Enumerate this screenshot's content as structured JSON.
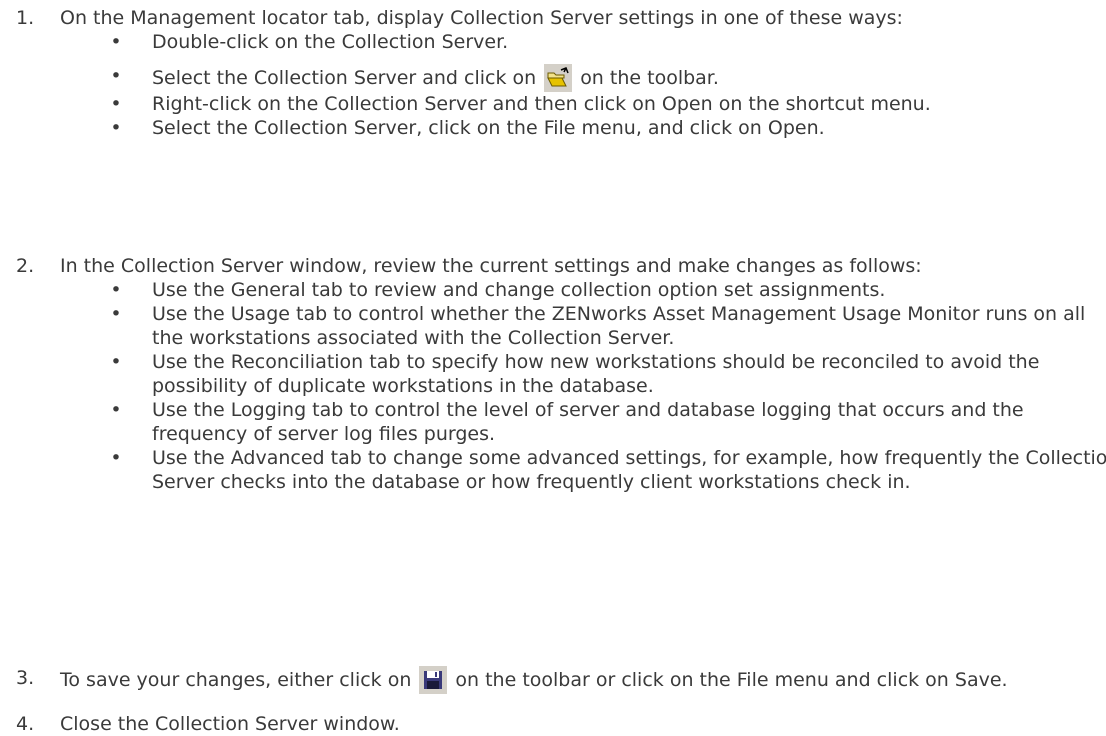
{
  "steps": [
    {
      "number": "1.",
      "text": "On the Management locator tab, display Collection Server settings in one of these ways:",
      "bullets": [
        {
          "text": "Double-click on the Collection Server."
        },
        {
          "text_before": "Select the Collection Server and click on",
          "icon": "open-folder-icon",
          "text_after": "on the toolbar."
        },
        {
          "text": "Right-click on the Collection Server and then click on Open on the shortcut menu."
        },
        {
          "text": "Select the Collection Server, click on the File menu, and click on Open."
        }
      ]
    },
    {
      "number": "2.",
      "text": "In the Collection Server window, review the current settings and make changes as follows:",
      "bullets": [
        {
          "text": "Use the General tab to review and change collection option set assignments."
        },
        {
          "text": "Use the Usage tab to control whether the ZENworks Asset Management Usage Monitor runs on all the workstations associated with the Collection Server."
        },
        {
          "text": "Use the Reconciliation tab to specify how new workstations should be reconciled to avoid the possibility of duplicate workstations in the database."
        },
        {
          "text": "Use the Logging tab to control the level of server and database logging that occurs and the frequency of server log files purges."
        },
        {
          "text": "Use the Advanced tab to change some advanced settings, for example, how frequently the Collection Server checks into the database or how frequently client workstations check in."
        }
      ]
    },
    {
      "number": "3.",
      "text_before": "To save your changes, either click on",
      "icon": "save-disk-icon",
      "text_after": "on the toolbar or click on the File menu and click on Save."
    },
    {
      "number": "4.",
      "text": "Close the Collection Server window."
    }
  ],
  "bullet_glyph": "•",
  "colors": {
    "text": "#3a3a3a",
    "folder": "#e6c200",
    "disk": "#4a4a8a"
  }
}
